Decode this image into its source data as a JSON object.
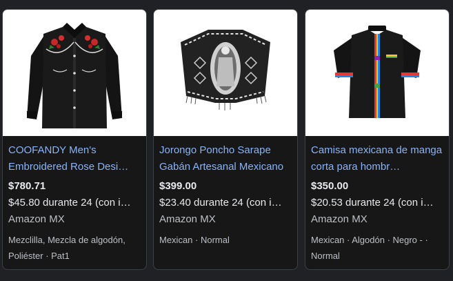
{
  "products": [
    {
      "image_icon": "embroidered-western-shirt",
      "title": "COOFANDY Men's Embroidered Rose Desi…",
      "price": "$780.71",
      "installment": "$45.80 durante 24 (con i…",
      "merchant": "Amazon MX",
      "tags": "Mezclilla, Mezcla de algodón, Poliéster · Pat1"
    },
    {
      "image_icon": "poncho-sarape",
      "title": "Jorongo Poncho Sarape Gabán Artesanal Mexicano",
      "price": "$399.00",
      "installment": "$23.40 durante 24 (con i…",
      "merchant": "Amazon MX",
      "tags": "Mexican · Normal"
    },
    {
      "image_icon": "mexican-short-sleeve-shirt",
      "title": "Camisa mexicana de manga corta para hombr…",
      "price": "$350.00",
      "installment": "$20.53 durante 24 (con i…",
      "merchant": "Amazon MX",
      "tags": "Mexican · Algodón · Negro - · Normal"
    }
  ],
  "colors": {
    "background": "#202124",
    "card": "#171717",
    "title_link": "#8ab4f8",
    "text": "#e8eaed",
    "muted": "#bdc1c6"
  }
}
